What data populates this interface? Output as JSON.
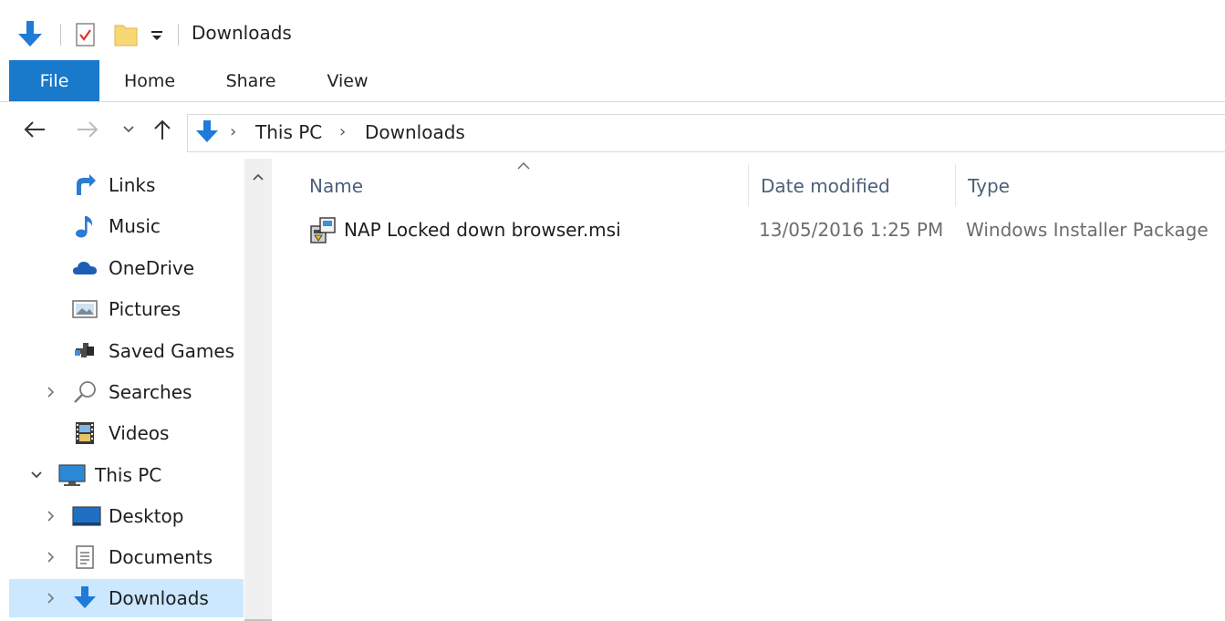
{
  "window": {
    "title": "Downloads"
  },
  "ribbon": {
    "tabs": [
      {
        "label": "File"
      },
      {
        "label": "Home"
      },
      {
        "label": "Share"
      },
      {
        "label": "View"
      }
    ]
  },
  "address": {
    "crumbs": [
      "This PC",
      "Downloads"
    ]
  },
  "nav": {
    "items": [
      {
        "label": "Links",
        "icon": "links-icon"
      },
      {
        "label": "Music",
        "icon": "music-icon"
      },
      {
        "label": "OneDrive",
        "icon": "onedrive-icon"
      },
      {
        "label": "Pictures",
        "icon": "pictures-icon"
      },
      {
        "label": "Saved Games",
        "icon": "saved-games-icon"
      },
      {
        "label": "Searches",
        "icon": "searches-icon"
      },
      {
        "label": "Videos",
        "icon": "videos-icon"
      },
      {
        "label": "This PC",
        "icon": "this-pc-icon"
      },
      {
        "label": "Desktop",
        "icon": "desktop-icon"
      },
      {
        "label": "Documents",
        "icon": "documents-icon"
      },
      {
        "label": "Downloads",
        "icon": "downloads-icon"
      }
    ]
  },
  "columns": {
    "name": "Name",
    "date": "Date modified",
    "type": "Type"
  },
  "files": [
    {
      "name": "NAP Locked down browser.msi",
      "date": "13/05/2016 1:25 PM",
      "type": "Windows Installer Package"
    }
  ],
  "colors": {
    "accent": "#1979ca",
    "selection": "#cce8ff",
    "header_text": "#4c607a"
  }
}
